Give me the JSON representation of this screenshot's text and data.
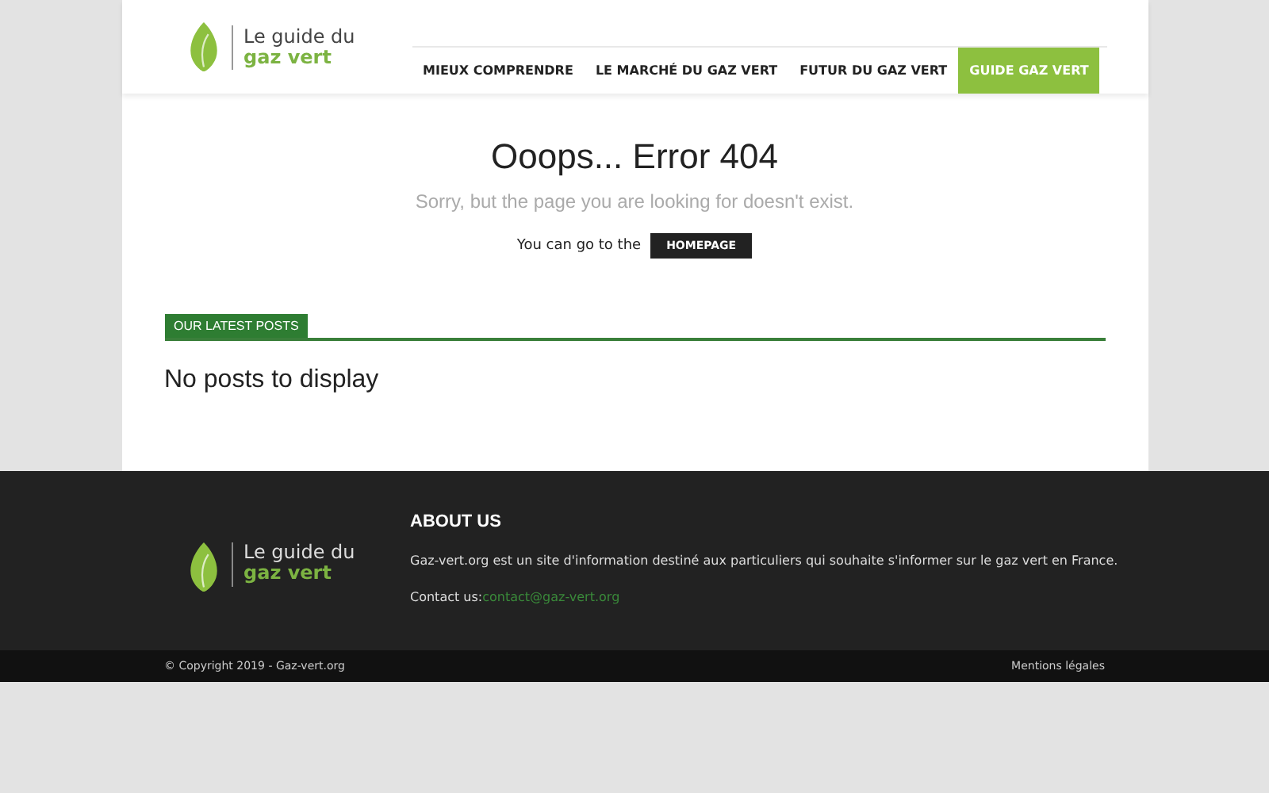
{
  "header": {
    "logo": {
      "line_1": "Le guide du",
      "line_2": "gaz vert"
    },
    "nav": [
      {
        "label": "MIEUX COMPRENDRE",
        "selected": false
      },
      {
        "label": "LE MARCHÉ DU GAZ VERT",
        "selected": false
      },
      {
        "label": "FUTUR DU GAZ VERT",
        "selected": false
      },
      {
        "label": "GUIDE GAZ VERT",
        "selected": true
      }
    ]
  },
  "error": {
    "title": "Ooops... Error 404",
    "message": "Sorry, but the page you are looking for doesn't exist.",
    "prompt": "You can go to the",
    "button": "HOMEPAGE"
  },
  "latest_posts": {
    "heading": "OUR LATEST POSTS",
    "empty_message": "No posts to display"
  },
  "footer": {
    "logo": {
      "line_1": "Le guide du",
      "line_2": "gaz vert"
    },
    "about_heading": "ABOUT US",
    "about_text": "Gaz-vert.org est un site d'information destiné aux particuliers qui souhaite s'informer sur le gaz vert en France.",
    "contact_label": "Contact us:",
    "contact_email": "contact@gaz-vert.org"
  },
  "bottom_bar": {
    "copyright": "© Copyright 2019 - Gaz-vert.org",
    "legal_link": "Mentions légales"
  }
}
